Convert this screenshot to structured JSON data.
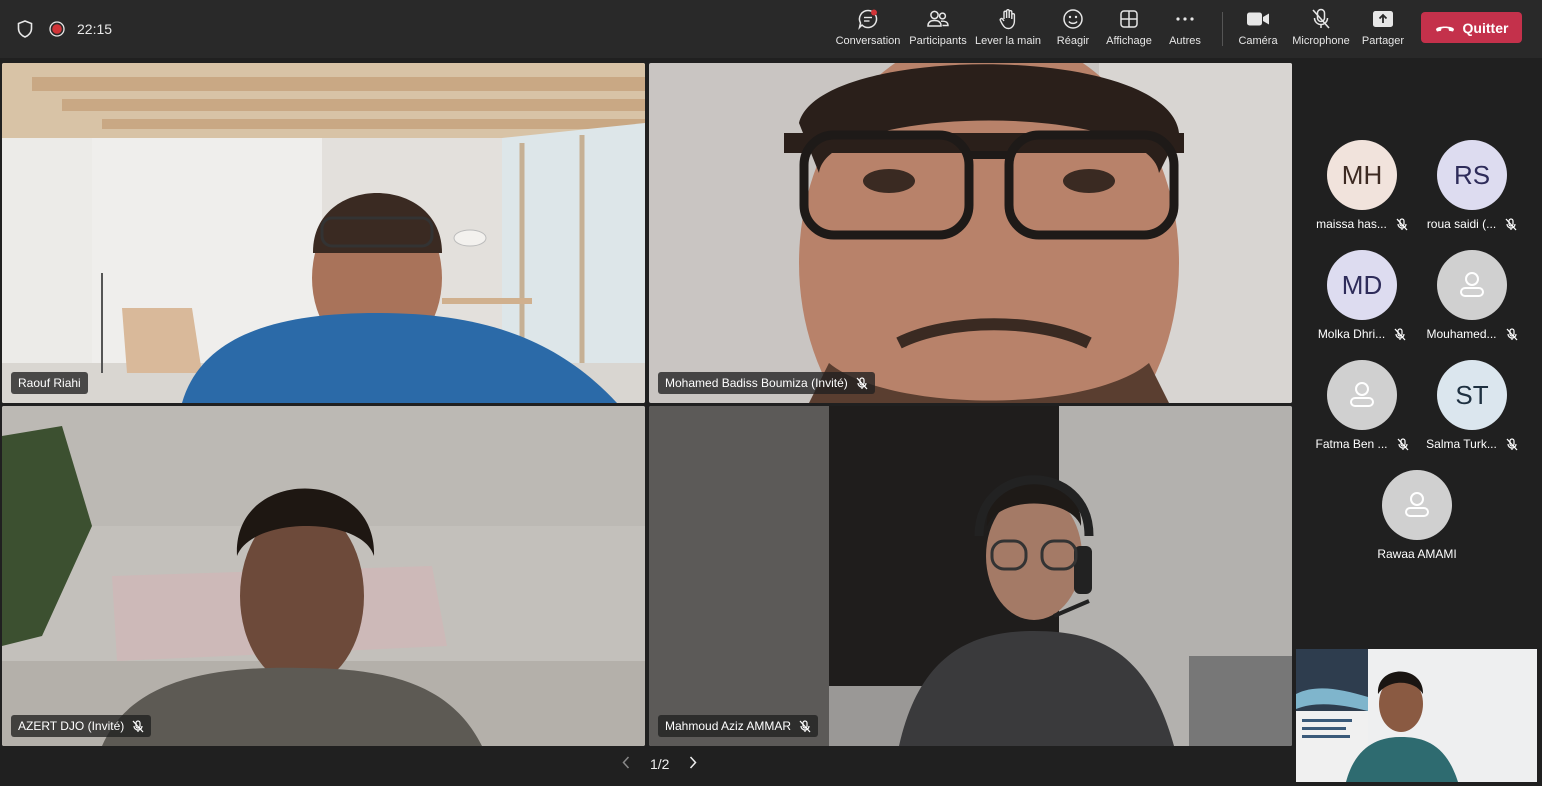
{
  "header": {
    "timer": "22:15",
    "toolbar": [
      {
        "id": "chat",
        "label": "Conversation",
        "icon": "chat-icon"
      },
      {
        "id": "participants",
        "label": "Participants",
        "icon": "people-icon"
      },
      {
        "id": "raise",
        "label": "Lever la main",
        "icon": "raise-hand-icon"
      },
      {
        "id": "react",
        "label": "Réagir",
        "icon": "emoji-icon"
      },
      {
        "id": "view",
        "label": "Affichage",
        "icon": "grid-icon"
      },
      {
        "id": "more",
        "label": "Autres",
        "icon": "more-icon"
      },
      {
        "id": "camera",
        "label": "Caméra",
        "icon": "camera-icon"
      },
      {
        "id": "mic",
        "label": "Microphone",
        "icon": "mic-off-icon"
      },
      {
        "id": "share",
        "label": "Partager",
        "icon": "share-icon"
      }
    ],
    "leave_label": "Quitter",
    "leave_color": "#c4314b"
  },
  "videos": [
    {
      "name": "Raouf Riahi",
      "muted": false
    },
    {
      "name": "Mohamed Badiss Boumiza (Invité)",
      "muted": true
    },
    {
      "name": "AZERT DJO (Invité)",
      "muted": true
    },
    {
      "name": "Mahmoud Aziz AMMAR",
      "muted": true
    }
  ],
  "participants": [
    {
      "initials": "MH",
      "name": "maissa has...",
      "muted": true,
      "color": "#f1e3dc"
    },
    {
      "initials": "RS",
      "name": "roua saidi (...",
      "muted": true,
      "color": "#dddcf0"
    },
    {
      "initials": "MD",
      "name": "Molka Dhri...",
      "muted": true,
      "color": "#dddcf0"
    },
    {
      "initials": "",
      "name": "Mouhamed...",
      "muted": true,
      "color": "#d0d0d0"
    },
    {
      "initials": "",
      "name": "Fatma Ben ...",
      "muted": true,
      "color": "#d0d0d0"
    },
    {
      "initials": "ST",
      "name": "Salma Turk...",
      "muted": true,
      "color": "#dbe6ee"
    },
    {
      "initials": "",
      "name": "Rawaa AMAMI",
      "muted": false,
      "color": "#d0d0d0"
    }
  ],
  "pager": {
    "label": "1/2"
  }
}
